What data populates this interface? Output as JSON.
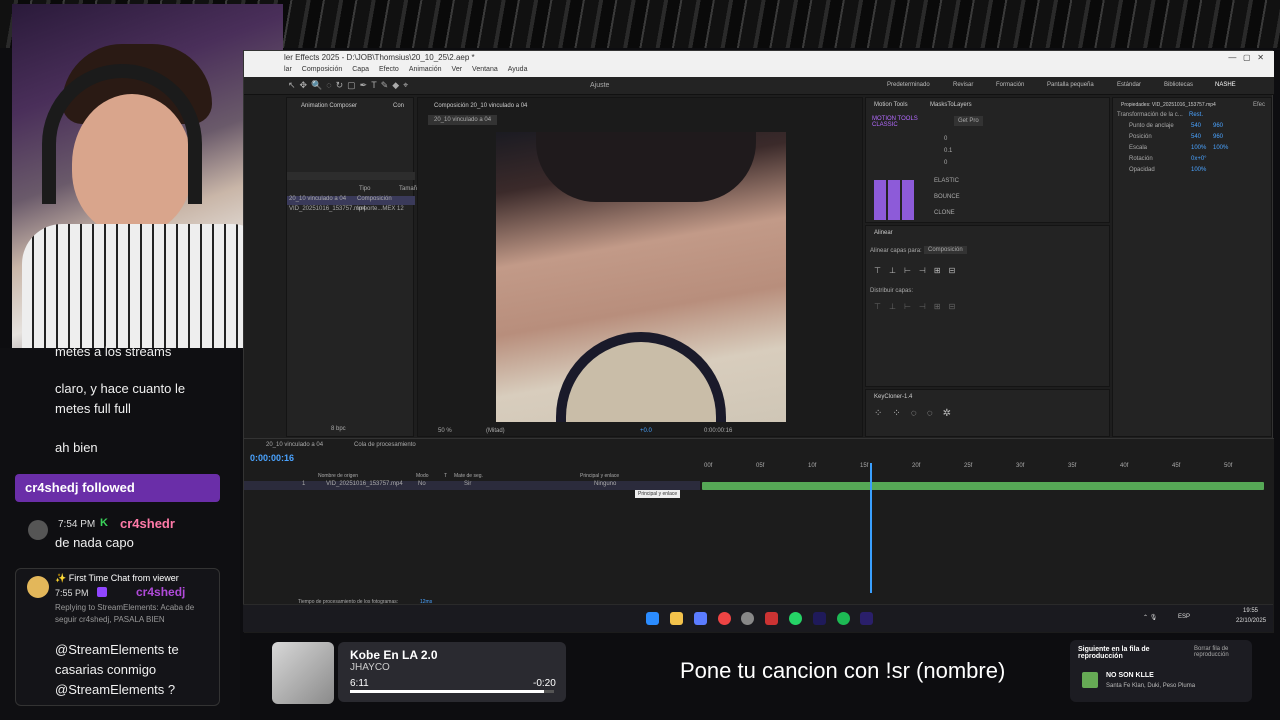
{
  "ae": {
    "title": "ler Effects 2025 - D:\\JOB\\Thomsius\\20_10_25\\2.aep *",
    "menu": [
      "lar",
      "Composición",
      "Capa",
      "Efecto",
      "Animación",
      "Ver",
      "Ventana",
      "Ayuda"
    ],
    "tool_label": "Ajuste",
    "workspaces": [
      "Predeterminado",
      "Revisar",
      "Formación",
      "Pantalla pequeña",
      "Estándar",
      "Bibliotecas",
      "NASHE"
    ],
    "project_tabs": [
      "Animation Composer",
      "Con"
    ],
    "project_rows": [
      {
        "name": "20_10 vinculado a 04",
        "type": "Composición"
      },
      {
        "name": "VID_20251016_153757.mp4",
        "type": "Importe...MEX  12"
      }
    ],
    "project_cols": {
      "type": "Tipo",
      "size": "Tamañ"
    },
    "bpc": "8 bpc",
    "comp_tab": "Composición 20_10 vinculado a 04",
    "comp_breadcrumb": "20_10 vinculado a 04",
    "viewer_zoom": "50 %",
    "viewer_res": "(Mitad)",
    "viewer_time": "0:00:00:16",
    "viewer_offset": "+0.0",
    "motion_tools": {
      "tab1": "Motion Tools",
      "tab2": "MasksToLayers",
      "brand": "MOTION TOOLS CLASSIC",
      "getpro": "Get Pro",
      "vals": [
        "0",
        "0.1",
        "0"
      ],
      "buttons": [
        "ELASTIC",
        "BOUNCE",
        "CLONE"
      ]
    },
    "align": {
      "title": "Alinear",
      "align_to_label": "Alinear capas para:",
      "align_to_value": "Composición",
      "distribute": "Distribuir capas:"
    },
    "keycloner": "KeyCloner-1.4",
    "properties": {
      "title": "Propiedades: VID_20251016_153757.mp4",
      "tab2": "Efec",
      "section": "Transformación de la c...",
      "reset": "Rest.",
      "rows": [
        {
          "label": "Punto de anclaje",
          "v1": "540",
          "v2": "960"
        },
        {
          "label": "Posición",
          "v1": "540",
          "v2": "960"
        },
        {
          "label": "Escala",
          "v1": "100%",
          "v2": "100%"
        },
        {
          "label": "Rotación",
          "v1": "0x+0°",
          "v2": ""
        },
        {
          "label": "Opacidad",
          "v1": "100%",
          "v2": ""
        }
      ]
    },
    "timeline": {
      "tab1": "20_10 vinculado a 04",
      "tab2": "Cola de procesamiento",
      "timecode": "0:00:00:16",
      "cols": [
        "Nombre de origen",
        "Modo",
        "T",
        "Mate de seg.",
        "Principal y enlace"
      ],
      "layer_num": "1",
      "layer_name": "VID_20251016_153757.mp4",
      "layer_mode": "No",
      "layer_matte": "Sir",
      "layer_parent": "Ninguno",
      "tooltip": "Principal y enlace",
      "ruler": [
        "00f",
        "05f",
        "10f",
        "15f",
        "20f",
        "25f",
        "30f",
        "35f",
        "40f",
        "45f",
        "50f"
      ],
      "render_time": "Tiempo de procesamiento de los fotogramas:",
      "render_value": "12ms"
    }
  },
  "taskbar": {
    "lang": "ESP",
    "time": "19:55",
    "date": "22/10/2025"
  },
  "chat": {
    "m0": "metes a los streams",
    "m1": "claro, y hace cuanto le metes full full",
    "m2": "ah bien",
    "follow": "cr4shedj followed",
    "m3_time": "7:54 PM",
    "m3_user": "cr4shedr",
    "m3_text": "de nada capo",
    "ftc_header": "First Time Chat from viewer",
    "ftc_time": "7:55 PM",
    "ftc_user": "cr4shedj",
    "ftc_reply": "Replying to StreamElements: Acaba de seguir cr4shedj, PASALA BIEN",
    "ftc_text": "@StreamElements te casarias conmigo @StreamElements ?"
  },
  "music": {
    "title": "Kobe En LA 2.0",
    "artist": "JHAYCO",
    "elapsed": "6:11",
    "remaining": "-0:20",
    "progress": 0.95
  },
  "song_request": "Pone tu cancion con !sr (nombre)",
  "queue": {
    "title": "Siguiente en la fila de reproducción",
    "clear": "Borrar fila de reproducción",
    "song": "NO SON KLLE",
    "artists": "Santa Fe Klan, Duki, Peso Pluma"
  }
}
